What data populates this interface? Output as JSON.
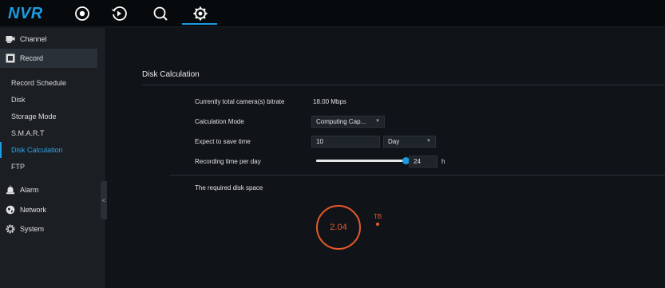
{
  "app": {
    "logo": "NVR"
  },
  "topnav": {
    "items": [
      {
        "icon": "live-view-icon"
      },
      {
        "icon": "playback-icon"
      },
      {
        "icon": "search-icon"
      },
      {
        "icon": "settings-gear-icon",
        "active": true
      }
    ],
    "accent_color": "#1d9be0"
  },
  "sidebar": {
    "groups": [
      {
        "label": "Channel",
        "icon": "camera-icon"
      },
      {
        "label": "Record",
        "icon": "record-icon",
        "active": true
      },
      {
        "label": "Alarm",
        "icon": "alarm-icon"
      },
      {
        "label": "Network",
        "icon": "network-icon"
      },
      {
        "label": "System",
        "icon": "system-gear-icon"
      }
    ],
    "record_items": [
      {
        "label": "Record Schedule"
      },
      {
        "label": "Disk"
      },
      {
        "label": "Storage Mode"
      },
      {
        "label": "S.M.A.R.T"
      },
      {
        "label": "Disk Calculation",
        "active": true
      },
      {
        "label": "FTP"
      }
    ],
    "collapse_glyph": "<"
  },
  "main": {
    "title": "Disk Calculation",
    "bitrate": {
      "label": "Currently total camera(s) bitrate",
      "value": "18.00 Mbps"
    },
    "mode": {
      "label": "Calculation Mode",
      "value": "Computing Cap..."
    },
    "save_time": {
      "label": "Expect to save time",
      "value": "10",
      "unit_value": "Day"
    },
    "per_day": {
      "label": "Recording time per day",
      "value": "24",
      "unit": "h",
      "fraction": 1.0
    },
    "required": {
      "label": "The required disk space",
      "value": "2.04",
      "unit": "TB"
    },
    "result_color": "#e8592a"
  }
}
